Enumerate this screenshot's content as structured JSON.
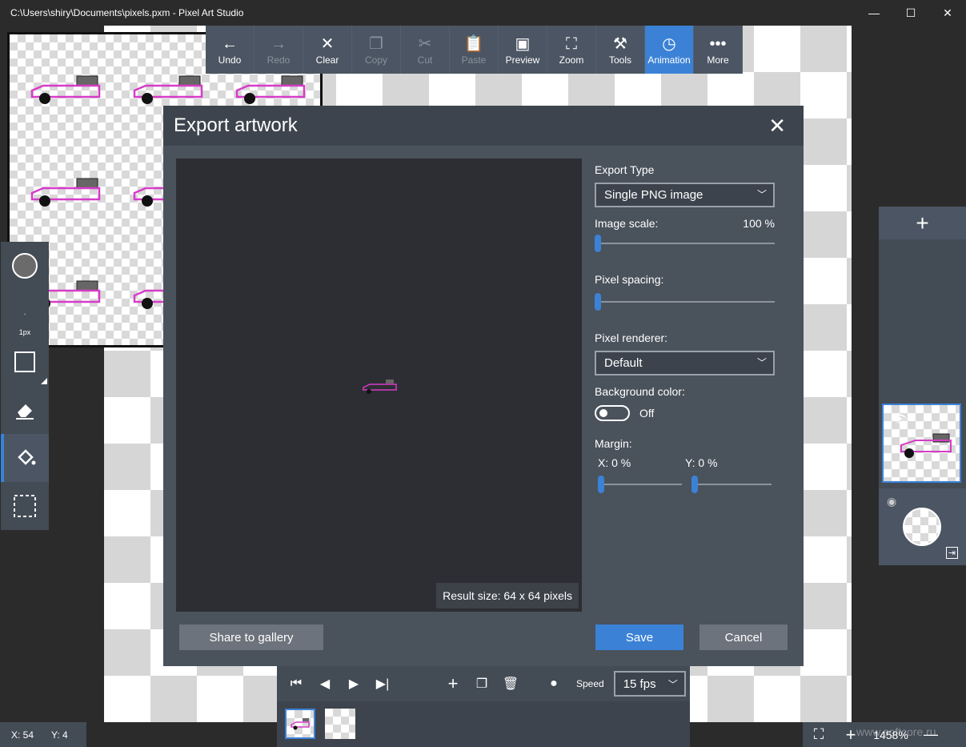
{
  "window": {
    "title": "C:\\Users\\shiry\\Documents\\pixels.pxm - Pixel Art Studio",
    "minimize": "—",
    "maximize": "☐",
    "close": "✕"
  },
  "toolbar": [
    {
      "icon": "arrow-left-icon",
      "glyph": "←",
      "label": "Undo",
      "state": "enabled"
    },
    {
      "icon": "arrow-right-icon",
      "glyph": "→",
      "label": "Redo",
      "state": "disabled"
    },
    {
      "icon": "x-icon",
      "glyph": "✕",
      "label": "Clear",
      "state": "enabled"
    },
    {
      "icon": "copy-icon",
      "glyph": "❐",
      "label": "Copy",
      "state": "disabled"
    },
    {
      "icon": "scissors-icon",
      "glyph": "✂",
      "label": "Cut",
      "state": "disabled"
    },
    {
      "icon": "paste-icon",
      "glyph": "📋",
      "label": "Paste",
      "state": "disabled"
    },
    {
      "icon": "preview-icon",
      "glyph": "▣",
      "label": "Preview",
      "state": "enabled"
    },
    {
      "icon": "zoom-icon",
      "glyph": "⛶",
      "label": "Zoom",
      "state": "enabled"
    },
    {
      "icon": "tools-icon",
      "glyph": "⚒",
      "label": "Tools",
      "state": "enabled"
    },
    {
      "icon": "clock-icon",
      "glyph": "◷",
      "label": "Animation",
      "state": "active"
    },
    {
      "icon": "more-icon",
      "glyph": "•••",
      "label": "More",
      "state": "enabled"
    }
  ],
  "tools": {
    "brush_size_label": "1px"
  },
  "dialog": {
    "title": "Export artwork",
    "result_size": "Result size: 64 x 64  pixels",
    "export_type_label": "Export Type",
    "export_type_value": "Single PNG image",
    "image_scale_label": "Image scale:",
    "image_scale_value": "100 %",
    "image_scale_level": 0,
    "pixel_spacing_label": "Pixel spacing:",
    "pixel_spacing_level": 0,
    "pixel_renderer_label": "Pixel renderer:",
    "pixel_renderer_value": "Default",
    "background_color_label": "Background color:",
    "background_toggle_label": "Off",
    "margin_label": "Margin:",
    "margin_x_label": "X: 0 %",
    "margin_y_label": "Y: 0 %",
    "share_button": "Share to gallery",
    "save_button": "Save",
    "cancel_button": "Cancel"
  },
  "animation": {
    "speed_label": "Speed",
    "speed_value": "15 fps"
  },
  "status": {
    "x": "X: 54",
    "y": "Y: 4",
    "zoom": "1458%",
    "watermark": "www.softcore.ru"
  },
  "colors": {
    "accent": "#3b82d6",
    "dialog_bg": "#4a525c",
    "car": "#d63cc8"
  }
}
